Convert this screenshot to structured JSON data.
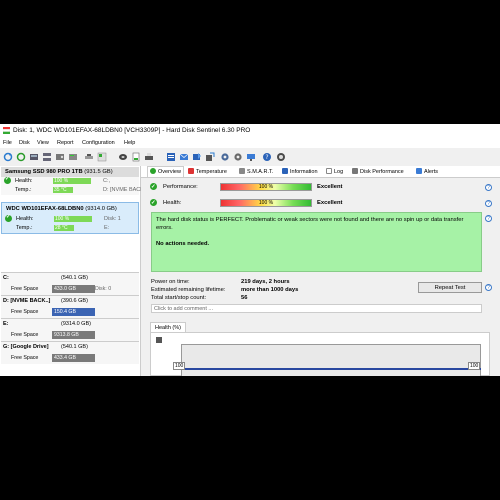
{
  "window": {
    "title": "Disk: 1, WDC WD101EFAX-68LDBN0 [VCH3309P]  -  Hard Disk Sentinel 6.30 PRO"
  },
  "menu": [
    "File",
    "Disk",
    "View",
    "Report",
    "Configuration",
    "Help"
  ],
  "disks": [
    {
      "name": "Samsung SSD 980 PRO 1TB",
      "size": "(931.5 GB)",
      "health_label": "Health:",
      "health": "100 %",
      "health_ext": "C:,",
      "temp_label": "Temp.:",
      "temp": "35 °C",
      "temp_ext": "D: [NVME BACKUP]"
    },
    {
      "name": "WDC WD101EFAX-68LDBN0",
      "size": "(9314.0 GB)",
      "health_label": "Health:",
      "health": "100 %",
      "health_ext": "Disk: 1",
      "temp_label": "Temp.:",
      "temp": "28 °C",
      "temp_ext": "E:"
    }
  ],
  "volumes": [
    {
      "name": "C:",
      "size": "(540.1 GB)",
      "free_label": "Free Space",
      "free": "433.0 GB",
      "ext": "Disk: 0",
      "bar_color": "#7a7a7a"
    },
    {
      "name": "D: [NVME BACK..]",
      "size": "(390.6 GB)",
      "free_label": "Free Space",
      "free": "150.4 GB",
      "ext": "",
      "bar_color": "#3b64b3"
    },
    {
      "name": "E:",
      "size": "(9314.0 GB)",
      "free_label": "Free Space",
      "free": "9313.8 GB",
      "ext": "",
      "bar_color": "#7a7a7a"
    },
    {
      "name": "G: [Google Drive]",
      "size": "(540.1 GB)",
      "free_label": "Free Space",
      "free": "433.4 GB",
      "ext": "",
      "bar_color": "#7a7a7a"
    }
  ],
  "tabs": [
    "Overview",
    "Temperature",
    "S.M.A.R.T.",
    "Information",
    "Log",
    "Disk Performance",
    "Alerts"
  ],
  "overview": {
    "performance_label": "Performance:",
    "performance": "100 %",
    "performance_text": "Excellent",
    "health_label": "Health:",
    "health": "100 %",
    "health_text": "Excellent",
    "status_message": "The hard disk status is PERFECT. Problematic or weak sectors were not found and there are no spin up or data transfer errors.",
    "actions": "No actions needed.",
    "power_on_label": "Power on time:",
    "power_on": "219 days, 2 hours",
    "remaining_label": "Estimated remaining lifetime:",
    "remaining": "more than 1000 days",
    "startstop_label": "Total start/stop count:",
    "startstop": "56",
    "repeat_button": "Repeat Test",
    "comment_placeholder": "Click to add comment ...",
    "health_tab": "Health (%)",
    "chart_y_left": "100",
    "chart_y_right": "100"
  }
}
